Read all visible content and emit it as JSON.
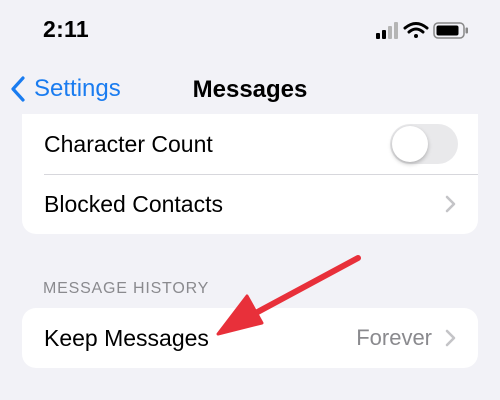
{
  "status_bar": {
    "time": "2:11",
    "icons": [
      "cellular-signal-icon",
      "wifi-icon",
      "battery-icon"
    ]
  },
  "nav": {
    "back_label": "Settings",
    "title": "Messages",
    "accent_color": "#1a7cf0"
  },
  "settings": {
    "rows": [
      {
        "label": "Character Count",
        "control": "toggle",
        "toggle_on": false
      },
      {
        "label": "Blocked Contacts",
        "control": "chevron-right-icon"
      }
    ]
  },
  "message_history": {
    "header": "MESSAGE HISTORY",
    "rows": [
      {
        "label": "Keep Messages",
        "value": "Forever",
        "control": "chevron-right-icon"
      }
    ]
  },
  "annotation": {
    "icon": "red-arrow-icon",
    "color": "#e8303a"
  }
}
